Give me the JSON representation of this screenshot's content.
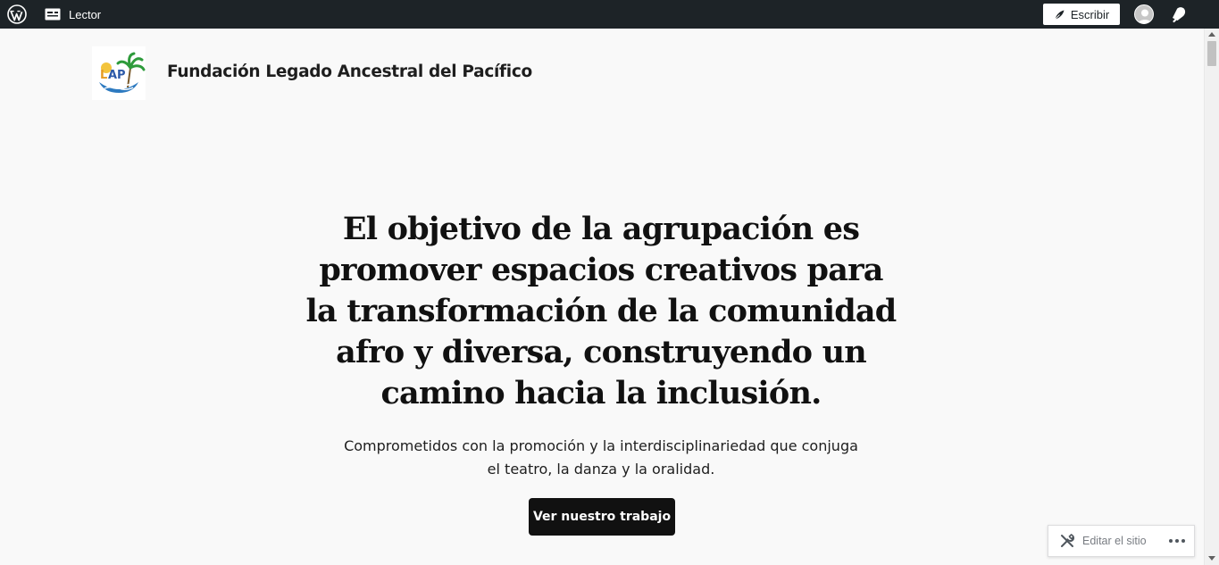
{
  "adminbar": {
    "wp_logo_icon": "wordpress-icon",
    "reader_label": "Lector",
    "reader_icon": "reader-icon",
    "write_label": "Escribir",
    "write_icon": "pen-icon",
    "avatar_icon": "avatar-icon",
    "notifications_icon": "bell-icon",
    "bg_color": "#1d2327"
  },
  "site": {
    "title": "Fundación Legado Ancestral del Pacífico",
    "logo_text": "LAP"
  },
  "hero": {
    "heading": "El objetivo de la agrupación es promover espacios creativos para la transformación de la comunidad afro y diversa, construyendo un camino hacia la inclusión.",
    "subtitle": "Comprometidos con la promoción y la interdisciplinariedad que conjuga el teatro, la danza y la oralidad.",
    "button_label": "Ver nuestro trabajo"
  },
  "edit_site": {
    "label": "Editar el sitio",
    "icon": "tools-icon",
    "more_icon": "ellipsis-icon"
  }
}
